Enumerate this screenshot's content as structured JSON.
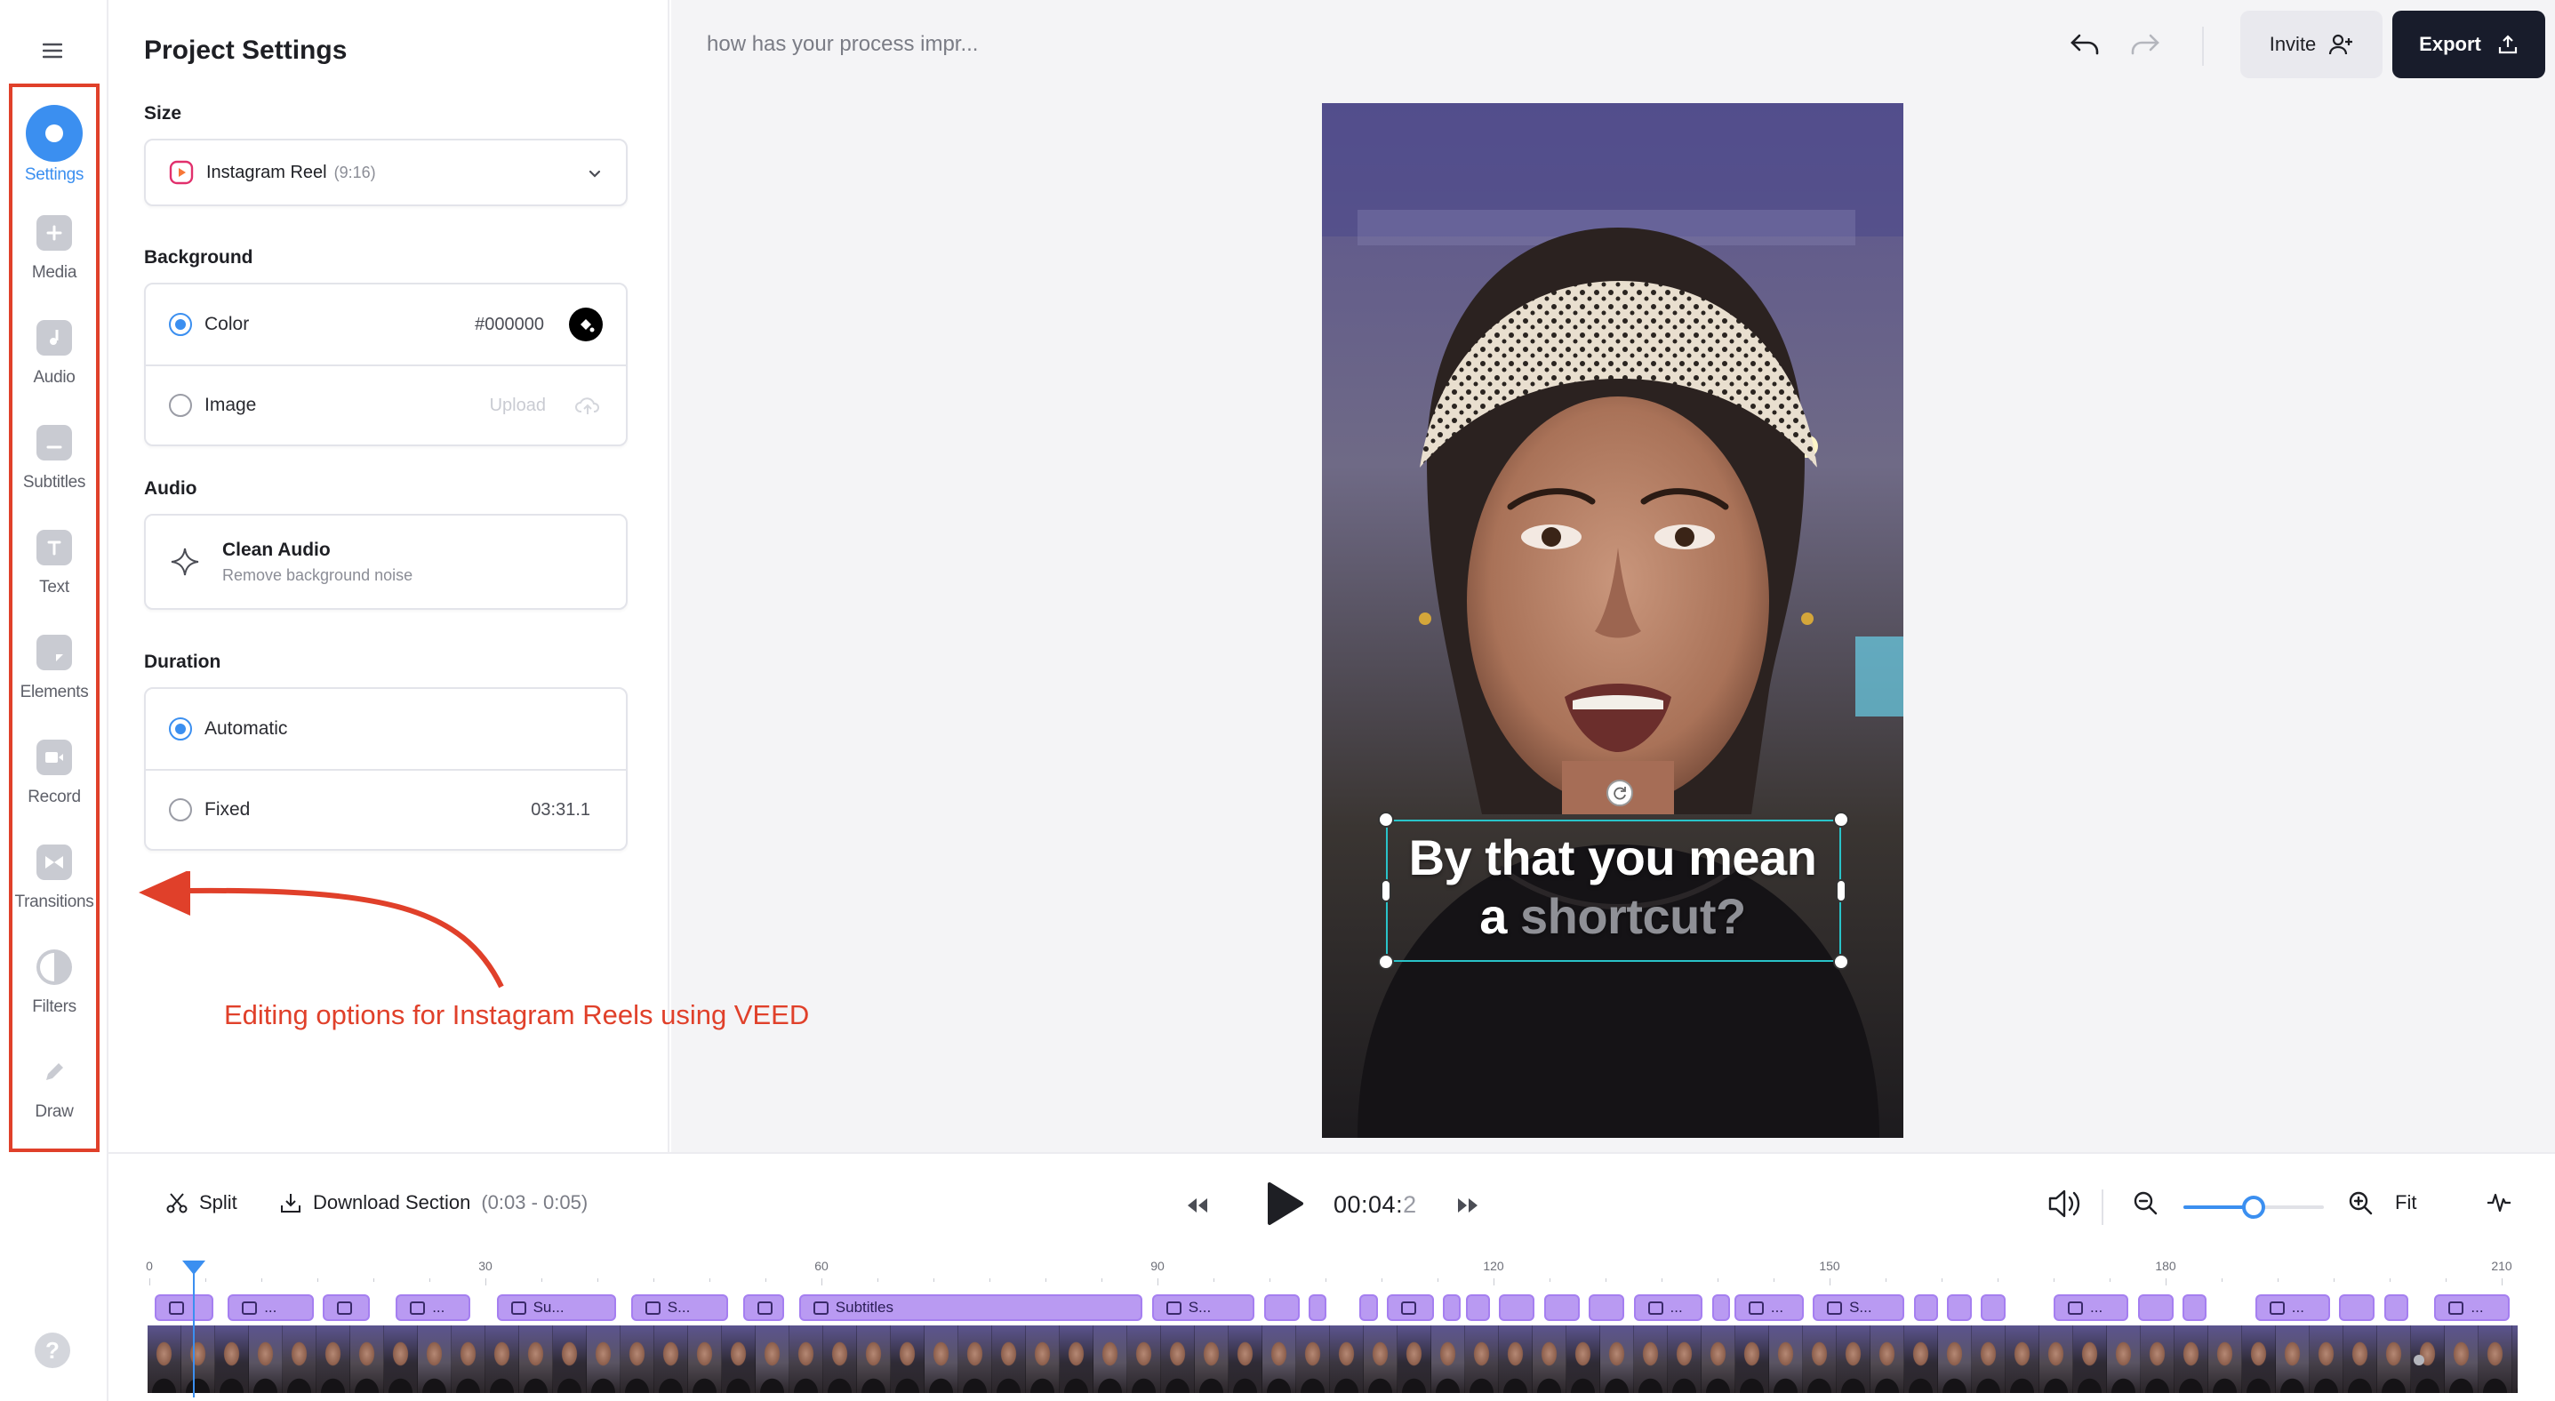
{
  "rail": {
    "items": [
      {
        "label": "Settings",
        "icon": "settings-icon",
        "active": true
      },
      {
        "label": "Media",
        "icon": "plus-icon"
      },
      {
        "label": "Audio",
        "icon": "music-note-icon"
      },
      {
        "label": "Subtitles",
        "icon": "subtitles-icon"
      },
      {
        "label": "Text",
        "icon": "text-icon"
      },
      {
        "label": "Elements",
        "icon": "sticker-icon"
      },
      {
        "label": "Record",
        "icon": "camera-icon"
      },
      {
        "label": "Transitions",
        "icon": "bowtie-icon"
      },
      {
        "label": "Filters",
        "icon": "half-circle-icon"
      },
      {
        "label": "Draw",
        "icon": "pencil-icon"
      }
    ],
    "help": "?"
  },
  "panel": {
    "title": "Project Settings",
    "size": {
      "label": "Size",
      "value": "Instagram Reel",
      "ratio": "(9:16)"
    },
    "background": {
      "label": "Background",
      "color_option": "Color",
      "color_value": "#000000",
      "image_option": "Image",
      "upload": "Upload"
    },
    "audio": {
      "label": "Audio",
      "title": "Clean Audio",
      "subtitle": "Remove background noise"
    },
    "duration": {
      "label": "Duration",
      "auto": "Automatic",
      "fixed": "Fixed",
      "fixed_value": "03:31.1"
    }
  },
  "annotation": {
    "text": "Editing options for Instagram Reels using VEED",
    "color": "#e0402a"
  },
  "topbar": {
    "title": "how has your process impr...",
    "invite": "Invite",
    "export": "Export"
  },
  "canvas": {
    "caption_line1": "By that you mean",
    "caption_word_a": "a",
    "caption_word_b": "shortcut?"
  },
  "transport": {
    "split": "Split",
    "download": "Download Section",
    "download_range": "(0:03 - 0:05)",
    "time": "00:04:",
    "time_dim": "2",
    "fit": "Fit",
    "zoom_level": 0.5
  },
  "timeline": {
    "ticks": [
      "0",
      "30",
      "60",
      "90",
      "120",
      "150",
      "180",
      "210"
    ],
    "playhead_seconds": 4,
    "clips": [
      {
        "start": 0.5,
        "end": 6,
        "label": ""
      },
      {
        "start": 7,
        "end": 15,
        "label": "..."
      },
      {
        "start": 15.5,
        "end": 20,
        "label": ""
      },
      {
        "start": 22,
        "end": 29,
        "label": "..."
      },
      {
        "start": 31,
        "end": 42,
        "label": "Su..."
      },
      {
        "start": 43,
        "end": 52,
        "label": "S..."
      },
      {
        "start": 53,
        "end": 57,
        "label": ""
      },
      {
        "start": 58,
        "end": 89,
        "label": "Subtitles"
      },
      {
        "start": 89.5,
        "end": 99,
        "label": "S..."
      },
      {
        "start": 99.5,
        "end": 103,
        "label": ""
      },
      {
        "start": 103.5,
        "end": 105,
        "label": ""
      },
      {
        "start": 108,
        "end": 110,
        "label": ""
      },
      {
        "start": 110.5,
        "end": 115,
        "label": ""
      },
      {
        "start": 115.5,
        "end": 117,
        "label": ""
      },
      {
        "start": 117.5,
        "end": 120,
        "label": ""
      },
      {
        "start": 120.5,
        "end": 124,
        "label": ""
      },
      {
        "start": 124.5,
        "end": 128,
        "label": ""
      },
      {
        "start": 128.5,
        "end": 132,
        "label": ""
      },
      {
        "start": 132.5,
        "end": 139,
        "label": "..."
      },
      {
        "start": 139.5,
        "end": 141,
        "label": ""
      },
      {
        "start": 141.5,
        "end": 148,
        "label": "..."
      },
      {
        "start": 148.5,
        "end": 157,
        "label": "S..."
      },
      {
        "start": 157.5,
        "end": 160,
        "label": ""
      },
      {
        "start": 160.5,
        "end": 163,
        "label": ""
      },
      {
        "start": 163.5,
        "end": 166,
        "label": ""
      },
      {
        "start": 170,
        "end": 177,
        "label": "..."
      },
      {
        "start": 177.5,
        "end": 181,
        "label": ""
      },
      {
        "start": 181.5,
        "end": 184,
        "label": ""
      },
      {
        "start": 188,
        "end": 195,
        "label": "..."
      },
      {
        "start": 195.5,
        "end": 199,
        "label": ""
      },
      {
        "start": 199.5,
        "end": 202,
        "label": ""
      },
      {
        "start": 204,
        "end": 211,
        "label": "..."
      }
    ]
  },
  "colors": {
    "accent": "#3b8ff0",
    "export_bg": "#181c2b",
    "clip": "#b99af2",
    "selection": "#29c3c9"
  }
}
